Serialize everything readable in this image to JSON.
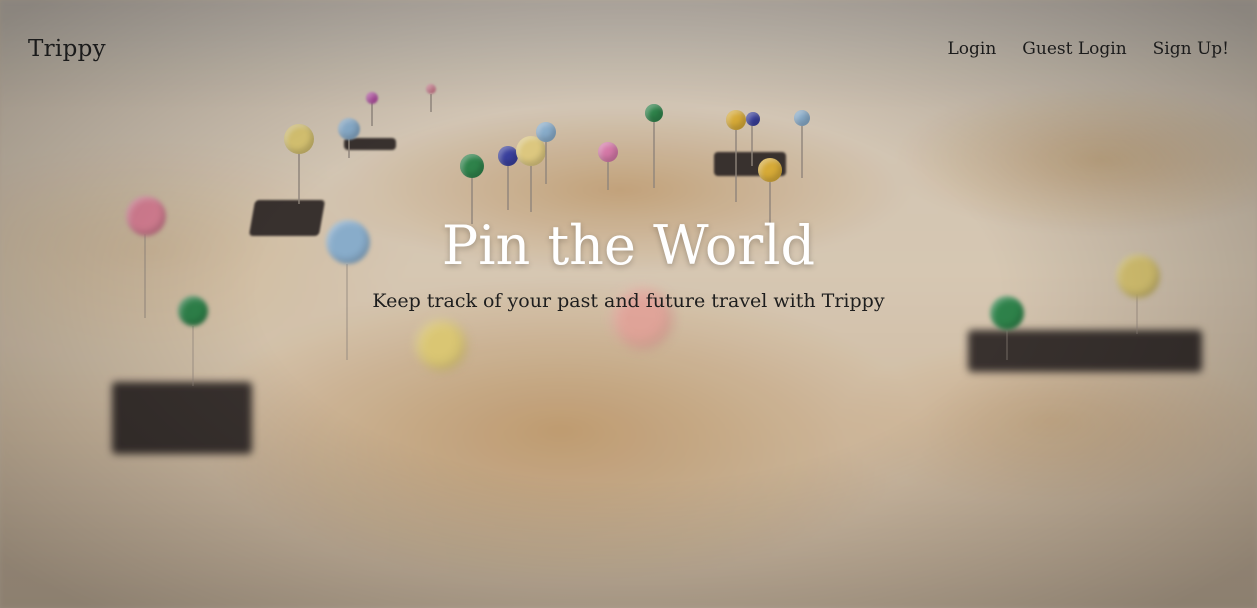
{
  "nav": {
    "brand": "Trippy",
    "links": [
      "Login",
      "Guest Login",
      "Sign Up!"
    ]
  },
  "hero": {
    "title": "Pin the World",
    "subtitle": "Keep track of your past and future travel with Trippy"
  },
  "colors": {
    "title_text": "#ffffff",
    "nav_text": "#1b1b1b",
    "pin_yellow": "#e6d27a",
    "pin_pink": "#e88aa0",
    "pin_blue": "#8fb6d6",
    "pin_green": "#2f8a4e",
    "pin_navy": "#3b43a6",
    "pin_gold": "#e2b43a"
  }
}
